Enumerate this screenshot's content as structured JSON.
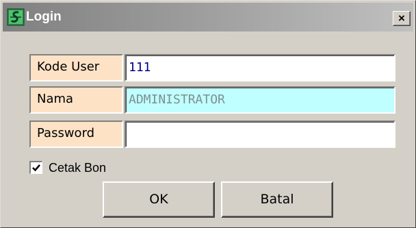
{
  "window": {
    "title": "Login",
    "close_label": "×"
  },
  "form": {
    "kode_user": {
      "label": "Kode User",
      "value": "111"
    },
    "nama": {
      "label": "Nama",
      "value": "ADMINISTRATOR"
    },
    "password": {
      "label": "Password",
      "value": ""
    }
  },
  "options": {
    "cetak_bon": {
      "label": "Cetak Bon",
      "checked": true
    }
  },
  "buttons": {
    "ok_label": "OK",
    "batal_label": "Batal"
  },
  "icons": {
    "app": "app-icon",
    "close": "close-icon",
    "check": "checkmark-icon"
  },
  "colors": {
    "title_bar_start": "#808080",
    "label_background": "#fde2c6",
    "nama_field_background": "#c0ffff",
    "kode_user_text": "#000080",
    "window_face": "#d4d0c8"
  }
}
